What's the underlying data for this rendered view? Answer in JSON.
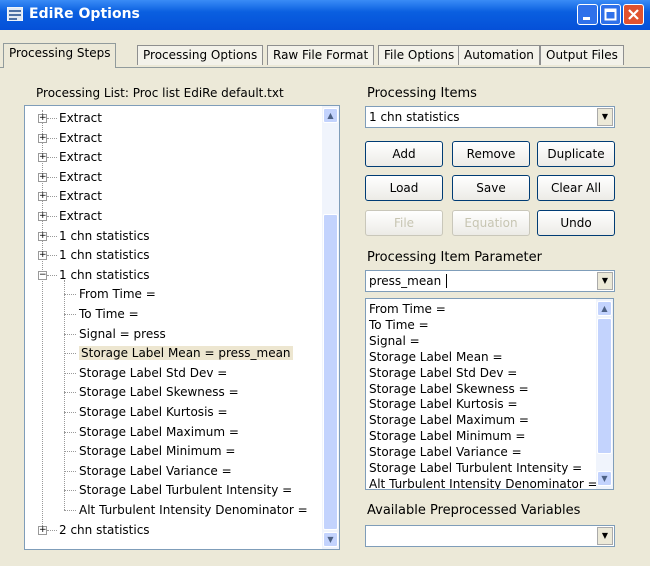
{
  "window": {
    "title": "EdiRe Options"
  },
  "tabs": [
    {
      "label": "Processing Steps",
      "active": true
    },
    {
      "label": "Processing Options",
      "active": false
    },
    {
      "label": "Raw File Format",
      "active": false
    },
    {
      "label": "File Options",
      "active": false
    },
    {
      "label": "Automation",
      "active": false
    },
    {
      "label": "Output Files",
      "active": false
    }
  ],
  "processing_list": {
    "label": "Processing List: Proc list EdiRe default.txt",
    "nodes": [
      {
        "text": "Extract",
        "state": "collapsed"
      },
      {
        "text": "Extract",
        "state": "collapsed"
      },
      {
        "text": "Extract",
        "state": "collapsed"
      },
      {
        "text": "Extract",
        "state": "collapsed"
      },
      {
        "text": "Extract",
        "state": "collapsed"
      },
      {
        "text": "Extract",
        "state": "collapsed"
      },
      {
        "text": "1 chn statistics",
        "state": "collapsed"
      },
      {
        "text": "1 chn statistics",
        "state": "collapsed"
      },
      {
        "text": "1 chn statistics",
        "state": "expanded"
      },
      {
        "text": "From Time =",
        "state": "child"
      },
      {
        "text": "To Time =",
        "state": "child"
      },
      {
        "text": "Signal = press",
        "state": "child"
      },
      {
        "text": "Storage Label Mean = press_mean",
        "state": "child-selected"
      },
      {
        "text": "Storage Label Std Dev =",
        "state": "child"
      },
      {
        "text": "Storage Label Skewness =",
        "state": "child"
      },
      {
        "text": "Storage Label Kurtosis =",
        "state": "child"
      },
      {
        "text": "Storage Label Maximum =",
        "state": "child"
      },
      {
        "text": "Storage Label Minimum =",
        "state": "child"
      },
      {
        "text": "Storage Label Variance =",
        "state": "child"
      },
      {
        "text": "Storage Label Turbulent Intensity =",
        "state": "child"
      },
      {
        "text": "Alt Turbulent Intensity Denominator =",
        "state": "child"
      },
      {
        "text": "2 chn statistics",
        "state": "collapsed"
      }
    ]
  },
  "processing_items": {
    "label": "Processing Items",
    "selected": "1 chn statistics"
  },
  "buttons": {
    "add": "Add",
    "remove": "Remove",
    "duplicate": "Duplicate",
    "load": "Load",
    "save": "Save",
    "clear_all": "Clear All",
    "file": "File",
    "equation": "Equation",
    "undo": "Undo"
  },
  "parameter": {
    "label": "Processing Item Parameter",
    "value": "press_mean",
    "list": [
      "From Time =",
      "To Time =",
      "Signal =",
      "Storage Label Mean =",
      "Storage Label Std Dev =",
      "Storage Label Skewness =",
      "Storage Label Kurtosis =",
      "Storage Label Maximum =",
      "Storage Label Minimum =",
      "Storage Label Variance =",
      "Storage Label Turbulent Intensity =",
      "Alt Turbulent Intensity Denominator ="
    ]
  },
  "preprocessed": {
    "label": "Available Preprocessed Variables",
    "value": ""
  }
}
